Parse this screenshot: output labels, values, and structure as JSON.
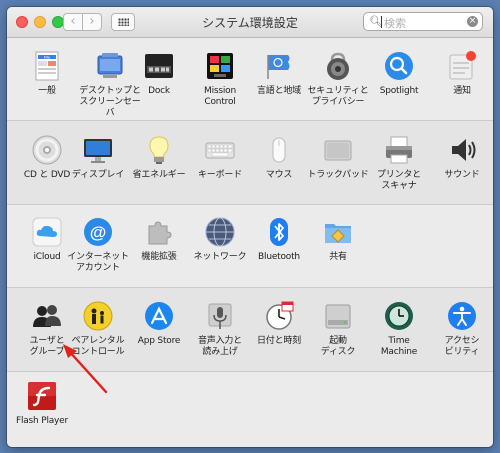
{
  "window": {
    "title": "システム環境設定",
    "search": {
      "placeholder": "検索",
      "icon": "search-icon"
    },
    "nav": {
      "back": "‹",
      "forward": "›"
    },
    "accent": "#1f7ff0"
  },
  "rows": [
    [
      {
        "label": "一般",
        "icon": "general-icon"
      },
      {
        "label": "デスクトップと\nスクリーンセーバ",
        "icon": "desktop-icon"
      },
      {
        "label": "Dock",
        "icon": "dock-icon"
      },
      {
        "label": "Mission\nControl",
        "icon": "mission-control-icon"
      },
      {
        "label": "言語と地域",
        "icon": "language-region-icon"
      },
      {
        "label": "セキュリティと\nプライバシー",
        "icon": "security-icon"
      },
      {
        "label": "Spotlight",
        "icon": "spotlight-icon"
      },
      {
        "label": "通知",
        "icon": "notifications-icon"
      }
    ],
    [
      {
        "label": "CD と DVD",
        "icon": "cd-dvd-icon"
      },
      {
        "label": "ディスプレイ",
        "icon": "display-icon"
      },
      {
        "label": "省エネルギー",
        "icon": "energy-saver-icon"
      },
      {
        "label": "キーボード",
        "icon": "keyboard-icon"
      },
      {
        "label": "マウス",
        "icon": "mouse-icon"
      },
      {
        "label": "トラックパッド",
        "icon": "trackpad-icon"
      },
      {
        "label": "プリンタと\nスキャナ",
        "icon": "printer-icon"
      },
      {
        "label": "サウンド",
        "icon": "sound-icon"
      }
    ],
    [
      {
        "label": "iCloud",
        "icon": "icloud-icon"
      },
      {
        "label": "インターネット\nアカウント",
        "icon": "internet-accounts-icon"
      },
      {
        "label": "機能拡張",
        "icon": "extensions-icon"
      },
      {
        "label": "ネットワーク",
        "icon": "network-icon"
      },
      {
        "label": "Bluetooth",
        "icon": "bluetooth-icon"
      },
      {
        "label": "共有",
        "icon": "sharing-icon"
      }
    ],
    [
      {
        "label": "ユーザと\nグループ",
        "icon": "users-groups-icon"
      },
      {
        "label": "ペアレンタル\nコントロール",
        "icon": "parental-controls-icon"
      },
      {
        "label": "App Store",
        "icon": "app-store-icon"
      },
      {
        "label": "音声入力と\n読み上げ",
        "icon": "dictation-icon"
      },
      {
        "label": "日付と時刻",
        "icon": "date-time-icon"
      },
      {
        "label": "起動\nディスク",
        "icon": "startup-disk-icon"
      },
      {
        "label": "Time\nMachine",
        "icon": "time-machine-icon"
      },
      {
        "label": "アクセシ\nビリティ",
        "icon": "accessibility-icon"
      }
    ],
    [
      {
        "label": "Flash Player",
        "icon": "flash-player-icon"
      }
    ]
  ]
}
